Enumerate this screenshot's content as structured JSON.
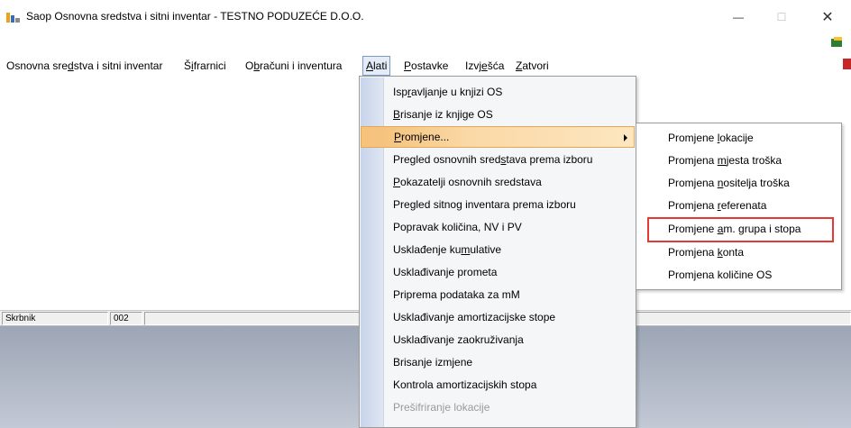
{
  "window": {
    "title": "Saop Osnovna sredstva i sitni inventar - TESTNO PODUZEĆE D.O.O.",
    "min_glyph": "—",
    "max_glyph": "☐",
    "close_glyph": "✕",
    "app_icon": "app-logo-icon"
  },
  "menubar": [
    {
      "pre": "Osnovna sre",
      "key": "d",
      "post": "stva i sitni inventar"
    },
    {
      "pre": "Š",
      "key": "i",
      "post": "frarnici"
    },
    {
      "pre": "O",
      "key": "b",
      "post": "računi i inventura"
    },
    {
      "pre": "",
      "key": "A",
      "post": "lati"
    },
    {
      "pre": "",
      "key": "P",
      "post": "ostavke"
    },
    {
      "pre": "Izvj",
      "key": "e",
      "post": "šća"
    },
    {
      "pre": "",
      "key": "Z",
      "post": "atvori"
    }
  ],
  "alati_menu": [
    {
      "pre": "Isp",
      "key": "r",
      "post": "avljanje u knjizi OS"
    },
    {
      "pre": "",
      "key": "B",
      "post": "risanje iz knjige OS"
    },
    {
      "pre": "",
      "key": "P",
      "post": "romjene..."
    },
    {
      "pre": "Pregled osnovnih sred",
      "key": "s",
      "post": "tava prema izboru"
    },
    {
      "pre": "",
      "key": "P",
      "post": "okazatelji osnovnih sredstava"
    },
    {
      "pre": "Pre",
      "key": "g",
      "post": "led sitnog inventara prema izboru"
    },
    {
      "pre": "Popravak količina, NV i PV",
      "key": "",
      "post": ""
    },
    {
      "pre": "Usklađenje ku",
      "key": "m",
      "post": "ulative"
    },
    {
      "pre": "Usklađivanje prometa",
      "key": "",
      "post": ""
    },
    {
      "pre": "Priprema podataka za mM",
      "key": "",
      "post": ""
    },
    {
      "pre": "Usklađivanje amortizacijske stope",
      "key": "",
      "post": ""
    },
    {
      "pre": "Usklađivanje zaokruživanja",
      "key": "",
      "post": ""
    },
    {
      "pre": "Brisanje izmjene",
      "key": "",
      "post": ""
    },
    {
      "pre": "Kontrola amortizacijskih stopa",
      "key": "",
      "post": ""
    },
    {
      "pre": "Prešifriranje lokacije",
      "key": "",
      "post": ""
    }
  ],
  "promjene_submenu": [
    {
      "pre": "Promjene ",
      "key": "l",
      "post": "okacije"
    },
    {
      "pre": "Promjena ",
      "key": "m",
      "post": "jesta troška"
    },
    {
      "pre": "Promjena ",
      "key": "n",
      "post": "ositelja troška"
    },
    {
      "pre": "Promjena ",
      "key": "r",
      "post": "eferenata"
    },
    {
      "pre": "Promjene ",
      "key": "a",
      "post": "m. grupa i stopa"
    },
    {
      "pre": "Promjena ",
      "key": "k",
      "post": "onta"
    },
    {
      "pre": "Promjena količine OS",
      "key": "",
      "post": ""
    }
  ],
  "statusbar": {
    "cell1": "Skrbnik",
    "cell2": "002",
    "cell3": ""
  },
  "colors": {
    "highlight": "#f5c37e",
    "annotation_box": "#e53935",
    "bottom_area": "#b3bac8"
  }
}
